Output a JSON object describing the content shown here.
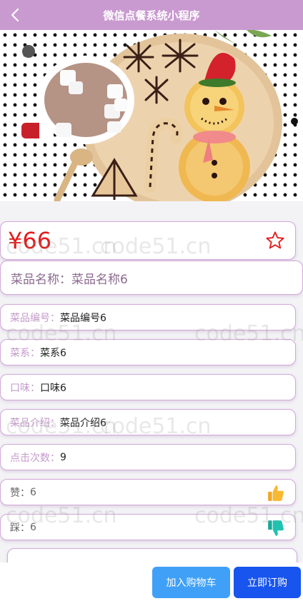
{
  "header": {
    "title": "微信点餐系统小程序"
  },
  "dish": {
    "price": "¥66",
    "name_label": "菜品名称：",
    "name_value": "菜品名称6",
    "fields": [
      {
        "label": "菜品编号：",
        "value": "菜品编号6"
      },
      {
        "label": "菜系：",
        "value": "菜系6"
      },
      {
        "label": "口味：",
        "value": "口味6"
      },
      {
        "label": "菜品介绍：",
        "value": "菜品介绍6"
      },
      {
        "label": "点击次数：",
        "value": "9"
      }
    ],
    "like_label": "赞：",
    "like_value": "6",
    "dislike_label": "踩：",
    "dislike_value": "6"
  },
  "actions": {
    "add_cart": "加入购物车",
    "buy_now": "立即订购"
  },
  "watermark": "code51.cn",
  "colors": {
    "header": "#c99ad0",
    "price": "#e31b1b",
    "cart_button": "#40a0f8",
    "buy_button": "#1854ee"
  },
  "icons": {
    "back": "chevron-left-icon",
    "favorite": "star-outline-icon",
    "like": "thumbs-up-icon",
    "dislike": "thumbs-down-icon"
  }
}
